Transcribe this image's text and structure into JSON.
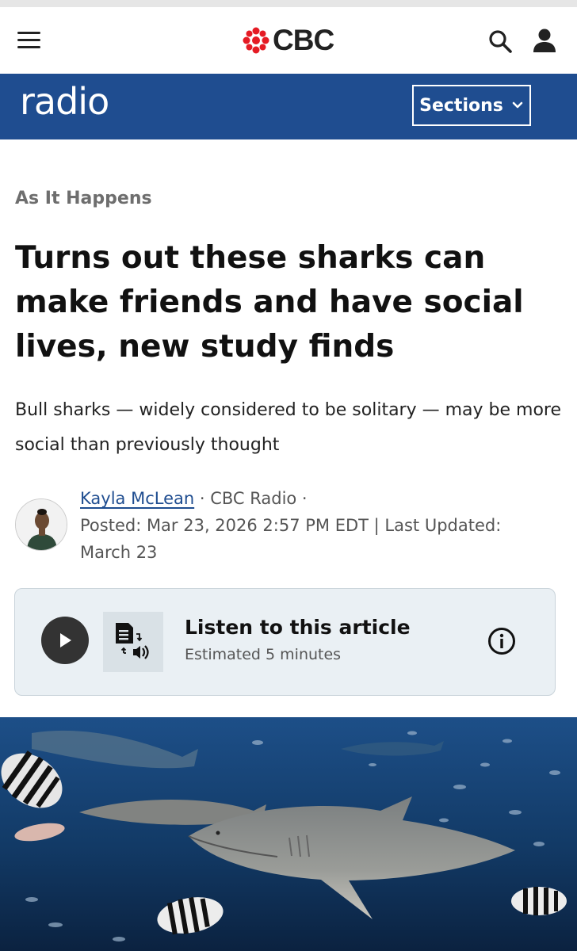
{
  "header": {
    "brand": "CBC",
    "section_brand": "radio",
    "sections_label": "Sections"
  },
  "article": {
    "show": "As It Happens",
    "headline": "Turns out these sharks can make friends and have social lives, new study finds",
    "deck": "Bull sharks — widely considered to be solitary — may be more social than previously thought",
    "author": "Kayla McLean",
    "outlet": "· CBC Radio ·",
    "posted": "Posted: Mar 23, 2026 2:57 PM EDT | Last Updated: March 23"
  },
  "audio": {
    "title": "Listen to this article",
    "estimate": "Estimated 5 minutes"
  },
  "icons": {
    "menu": "hamburger-menu-icon",
    "search": "search-icon",
    "account": "user-account-icon",
    "chevron": "chevron-down-icon",
    "play": "play-icon",
    "doc_audio": "text-to-speech-icon",
    "info": "info-icon"
  },
  "colors": {
    "radio_blue": "#1f4d90",
    "cbc_red": "#e51b24",
    "card_bg": "#eaf0f4"
  }
}
